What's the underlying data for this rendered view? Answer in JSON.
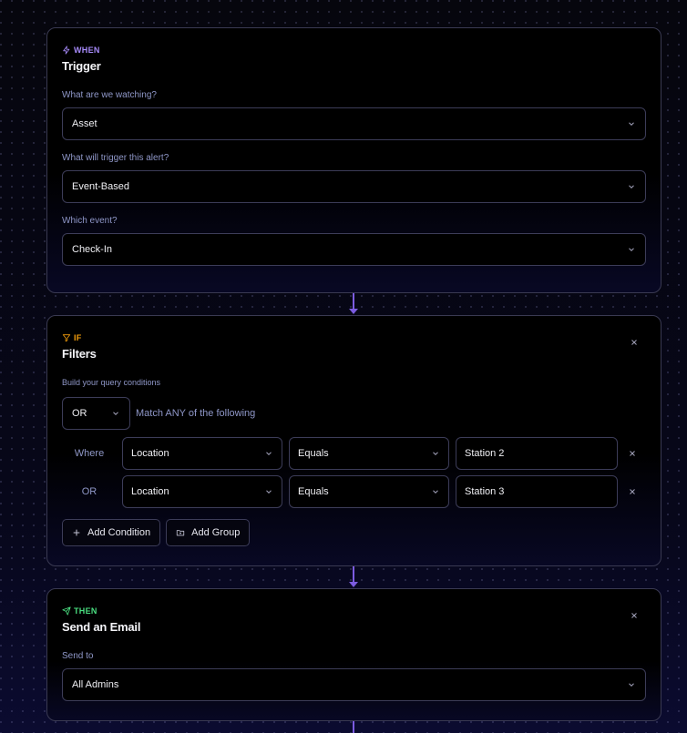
{
  "trigger": {
    "badge": "WHEN",
    "title": "Trigger",
    "watching_label": "What are we watching?",
    "watching_value": "Asset",
    "trigger_label": "What will trigger this alert?",
    "trigger_value": "Event-Based",
    "event_label": "Which event?",
    "event_value": "Check-In"
  },
  "filters": {
    "badge": "IF",
    "title": "Filters",
    "subtitle": "Build your query conditions",
    "logic_value": "OR",
    "match_text": "Match ANY of the following",
    "conditions": [
      {
        "prefix": "Where",
        "field": "Location",
        "operator": "Equals",
        "value": "Station 2"
      },
      {
        "prefix": "OR",
        "field": "Location",
        "operator": "Equals",
        "value": "Station 3"
      }
    ],
    "add_condition_label": "Add Condition",
    "add_group_label": "Add Group"
  },
  "action": {
    "badge": "THEN",
    "title": "Send an Email",
    "send_to_label": "Send to",
    "send_to_value": "All Admins"
  },
  "colors": {
    "accent": "#7c5ce0",
    "when": "#a78bfa",
    "if": "#f59e0b",
    "then": "#4ade80"
  }
}
